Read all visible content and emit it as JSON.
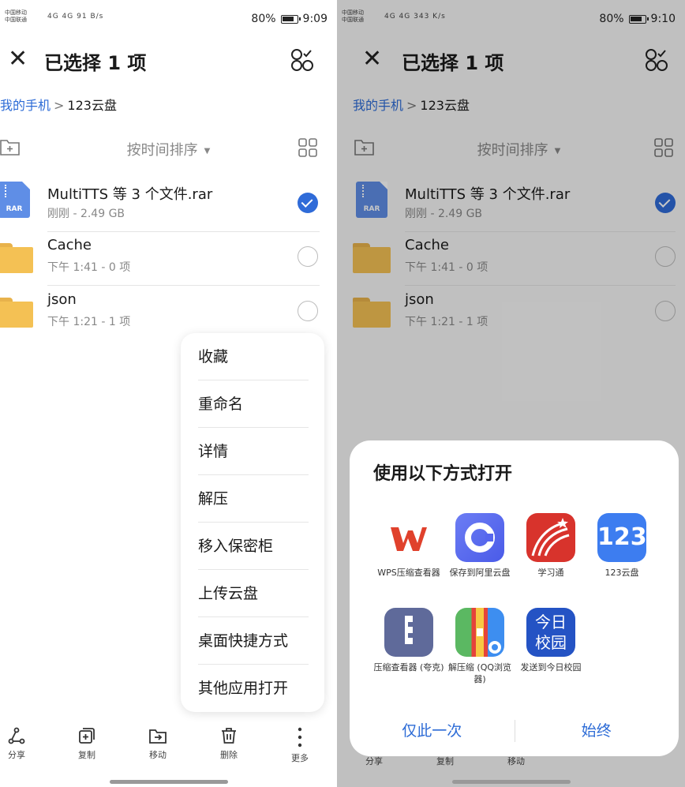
{
  "left": {
    "status": {
      "carrier1": "中国移动",
      "carrier2": "中国联通",
      "signal": "4G 4G",
      "speed": "91 B/s",
      "battery": "80%",
      "time": "9:09"
    },
    "title": "已选择 1 项",
    "breadcrumb": {
      "home": "我的手机",
      "separator": ">",
      "current": "123云盘"
    },
    "sort_label": "按时间排序",
    "files": [
      {
        "name": "MultiTTS 等 3 个文件.rar",
        "meta": "刚刚 - 2.49 GB",
        "icon": "rar-file-icon",
        "selected": true
      },
      {
        "name": "Cache",
        "meta": "下午 1:41 - 0 项",
        "icon": "folder-icon",
        "selected": false
      },
      {
        "name": "json",
        "meta": "下午 1:21 - 1 项",
        "icon": "folder-icon",
        "selected": false
      }
    ],
    "rar_badge": "RAR",
    "context_menu": [
      "收藏",
      "重命名",
      "详情",
      "解压",
      "移入保密柜",
      "上传云盘",
      "桌面快捷方式",
      "其他应用打开"
    ],
    "bottom_bar": [
      {
        "label": "分享",
        "icon": "share-icon"
      },
      {
        "label": "复制",
        "icon": "copy-icon"
      },
      {
        "label": "移动",
        "icon": "move-icon"
      },
      {
        "label": "删除",
        "icon": "trash-icon"
      },
      {
        "label": "更多",
        "icon": "more-icon"
      }
    ]
  },
  "right": {
    "status": {
      "carrier1": "中国移动",
      "carrier2": "中国联通",
      "signal": "4G 4G",
      "speed": "343 K/s",
      "battery": "80%",
      "time": "9:10"
    },
    "title": "已选择 1 项",
    "breadcrumb": {
      "home": "我的手机",
      "separator": ">",
      "current": "123云盘"
    },
    "sort_label": "按时间排序",
    "files": [
      {
        "name": "MultiTTS 等 3 个文件.rar",
        "meta": "刚刚 - 2.49 GB",
        "icon": "rar-file-icon",
        "selected": true
      },
      {
        "name": "Cache",
        "meta": "下午 1:41 - 0 项",
        "icon": "folder-icon",
        "selected": false
      },
      {
        "name": "json",
        "meta": "下午 1:21 - 1 项",
        "icon": "folder-icon",
        "selected": false
      }
    ],
    "rar_badge": "RAR",
    "sheet": {
      "title": "使用以下方式打开",
      "apps": [
        {
          "label": "WPS压缩查看器",
          "icon": "wps-icon"
        },
        {
          "label": "保存到阿里云盘",
          "icon": "aliyun-drive-icon"
        },
        {
          "label": "学习通",
          "icon": "xuexitong-icon"
        },
        {
          "label": "123云盘",
          "icon": "123pan-icon",
          "glyph": "123"
        },
        {
          "label": "压缩查看器 (夸克)",
          "icon": "quark-zip-icon"
        },
        {
          "label": "解压缩 (QQ浏览器)",
          "icon": "qq-unzip-icon"
        },
        {
          "label": "发送到今日校园",
          "icon": "jinrixiaoyuan-icon",
          "glyph": "今日 校园"
        }
      ],
      "once_label": "仅此一次",
      "always_label": "始终"
    },
    "bottom_bar_peek": [
      "分享",
      "复制",
      "移动"
    ]
  },
  "colors": {
    "accent": "#2c6bd6",
    "check": "#2f6bd8",
    "folder": "#f4c154",
    "rar": "#5f8ee6"
  }
}
